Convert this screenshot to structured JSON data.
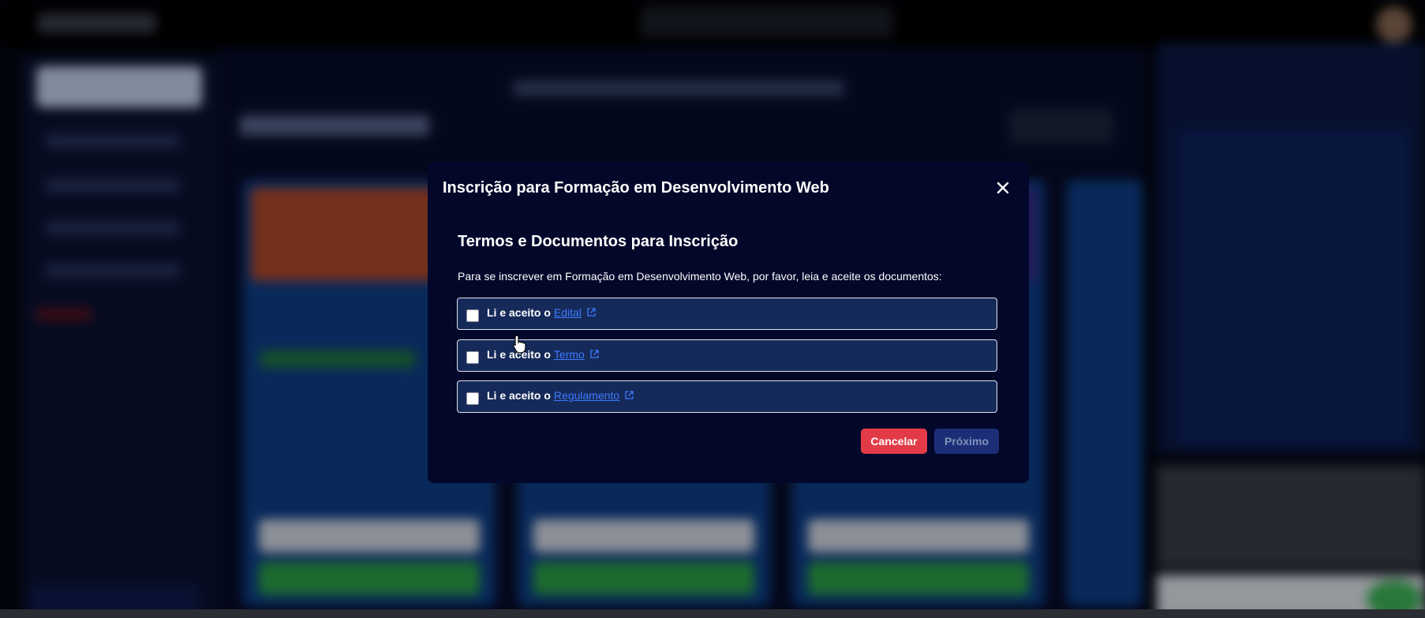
{
  "modal": {
    "title": "Inscrição para Formação em Desenvolvimento Web",
    "close_icon": "close-icon",
    "step_heading": "Termos e Documentos para Inscrição",
    "instructions": "Para se inscrever em Formação em Desenvolvimento Web, por favor, leia e aceite os documentos:",
    "documents": [
      {
        "prefix": "Li e aceito o",
        "link": "Edital",
        "checked": false,
        "icon": "external-link-icon"
      },
      {
        "prefix": "Li e aceito o",
        "link": "Termo",
        "checked": false,
        "icon": "external-link-icon"
      },
      {
        "prefix": "Li e aceito o",
        "link": "Regulamento",
        "checked": false,
        "icon": "external-link-icon"
      }
    ],
    "cancel_label": "Cancelar",
    "next_label": "Próximo"
  },
  "colors": {
    "modal_bg": "#03072a",
    "row_bg": "#162a5a",
    "link": "#3d7bff",
    "cancel_bg": "#e23b47",
    "next_bg": "#1c2e78"
  }
}
